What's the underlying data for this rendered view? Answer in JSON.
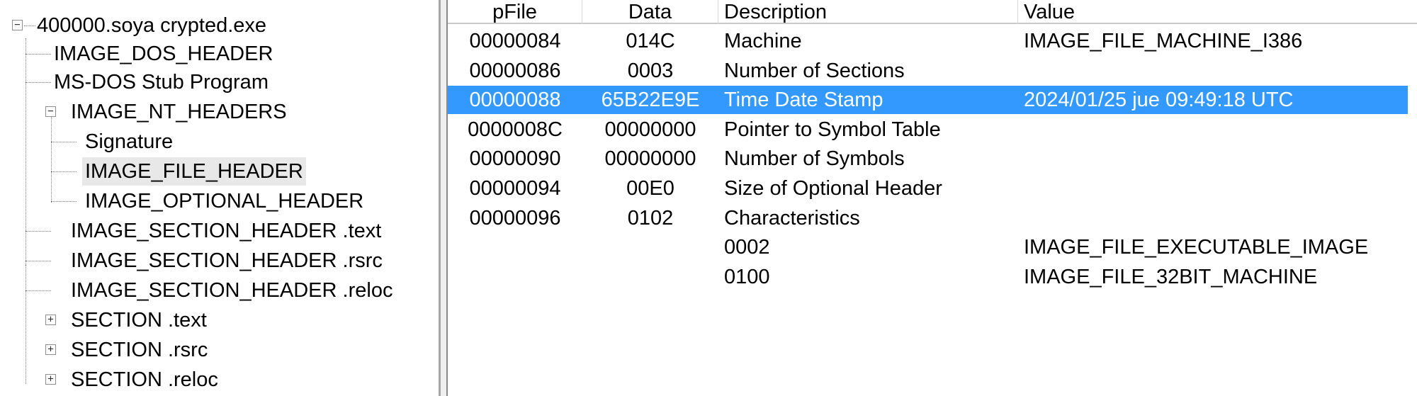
{
  "tree": {
    "root": "400000.soya crypted.exe",
    "dos_header": "IMAGE_DOS_HEADER",
    "stub": "MS-DOS Stub Program",
    "nt_headers": "IMAGE_NT_HEADERS",
    "signature": "Signature",
    "file_header": "IMAGE_FILE_HEADER",
    "optional_header": "IMAGE_OPTIONAL_HEADER",
    "sec_hdr_text": "IMAGE_SECTION_HEADER .text",
    "sec_hdr_rsrc": "IMAGE_SECTION_HEADER .rsrc",
    "sec_hdr_reloc": "IMAGE_SECTION_HEADER .reloc",
    "section_text": "SECTION .text",
    "section_rsrc": "SECTION .rsrc",
    "section_reloc": "SECTION .reloc",
    "selected": "IMAGE_FILE_HEADER"
  },
  "list": {
    "columns": [
      "pFile",
      "Data",
      "Description",
      "Value"
    ],
    "rows": [
      {
        "pfile": "00000084",
        "data": "014C",
        "description": "Machine",
        "value": "IMAGE_FILE_MACHINE_I386"
      },
      {
        "pfile": "00000086",
        "data": "0003",
        "description": "Number of Sections",
        "value": ""
      },
      {
        "pfile": "00000088",
        "data": "65B22E9E",
        "description": "Time Date Stamp",
        "value": "2024/01/25 jue 09:49:18 UTC"
      },
      {
        "pfile": "0000008C",
        "data": "00000000",
        "description": "Pointer to Symbol Table",
        "value": ""
      },
      {
        "pfile": "00000090",
        "data": "00000000",
        "description": "Number of Symbols",
        "value": ""
      },
      {
        "pfile": "00000094",
        "data": "00E0",
        "description": "Size of Optional Header",
        "value": ""
      },
      {
        "pfile": "00000096",
        "data": "0102",
        "description": "Characteristics",
        "value": ""
      },
      {
        "pfile": "",
        "data": "",
        "description": "0002",
        "value": "IMAGE_FILE_EXECUTABLE_IMAGE"
      },
      {
        "pfile": "",
        "data": "",
        "description": "0100",
        "value": "IMAGE_FILE_32BIT_MACHINE"
      }
    ],
    "selected_row": 2
  },
  "colors": {
    "selection": "#3399ff",
    "tree_selection": "#e8e8e8"
  }
}
